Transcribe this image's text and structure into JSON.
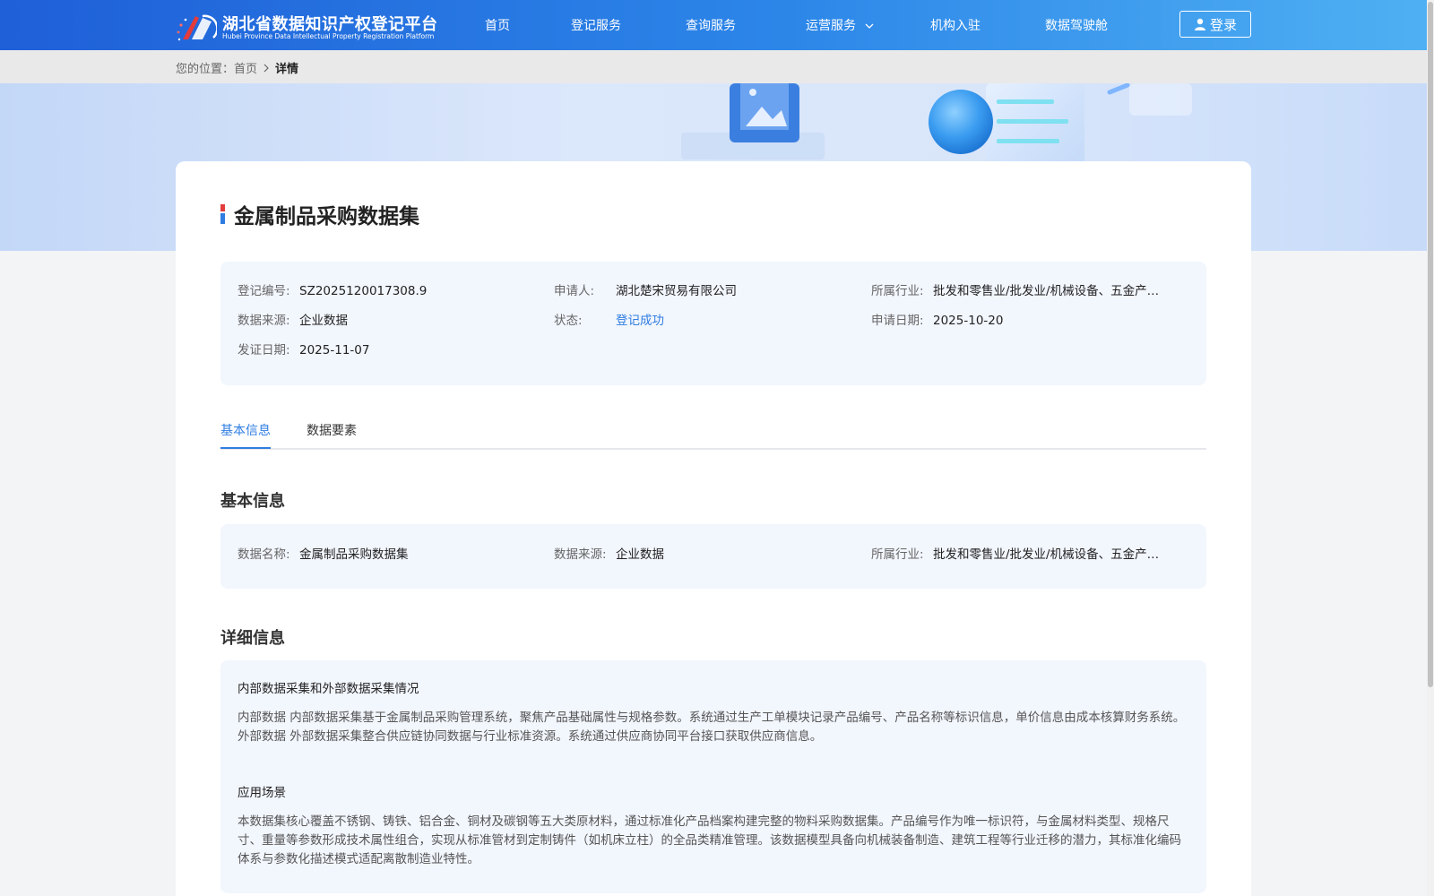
{
  "header": {
    "logo": {
      "title_cn": "湖北省数据知识产权登记平台",
      "title_en": "Hubei Province Data Intellectual Property Registration Platform"
    },
    "nav": [
      {
        "label": "首页"
      },
      {
        "label": "登记服务"
      },
      {
        "label": "查询服务"
      },
      {
        "label": "运营服务",
        "has_dropdown": true
      },
      {
        "label": "机构入驻"
      },
      {
        "label": "数据驾驶舱"
      }
    ],
    "login_label": "登录",
    "colors": {
      "gradient_start": "#1f5fd8",
      "gradient_end": "#4fb0f3"
    }
  },
  "breadcrumb": {
    "prefix": "您的位置：",
    "home": "首页",
    "current": "详情"
  },
  "detail": {
    "title": "金属制品采购数据集",
    "summary": {
      "reg_no_label": "登记编号:",
      "reg_no": "SZ2025120017308.9",
      "applicant_label": "申请人:",
      "applicant": "湖北楚宋贸易有限公司",
      "industry_label": "所属行业:",
      "industry": "批发和零售业/批发业/机械设备、五金产…",
      "source_label": "数据来源:",
      "source": "企业数据",
      "status_label": "状态:",
      "status": "登记成功",
      "apply_date_label": "申请日期:",
      "apply_date": "2025-10-20",
      "cert_date_label": "发证日期:",
      "cert_date": "2025-11-07"
    },
    "tabs": [
      {
        "label": "基本信息",
        "active": true
      },
      {
        "label": "数据要素",
        "active": false
      }
    ],
    "basic": {
      "heading": "基本信息",
      "name_label": "数据名称:",
      "name": "金属制品采购数据集",
      "source_label": "数据来源:",
      "source": "企业数据",
      "industry_label": "所属行业:",
      "industry": "批发和零售业/批发业/机械设备、五金产…"
    },
    "detailed": {
      "heading": "详细信息",
      "collection_heading": "内部数据采集和外部数据采集情况",
      "collection_text": "内部数据 内部数据采集基于金属制品采购管理系统，聚焦产品基础属性与规格参数。系统通过生产工单模块记录产品编号、产品名称等标识信息，单价信息由成本核算财务系统。 外部数据 外部数据采集整合供应链协同数据与行业标准资源。系统通过供应商协同平台接口获取供应商信息。",
      "scenario_heading": "应用场景",
      "scenario_text": "本数据集核心覆盖不锈钢、铸铁、铝合金、铜材及碳钢等五大类原材料，通过标准化产品档案构建完整的物料采购数据集。产品编号作为唯一标识符，与金属材料类型、规格尺寸、重量等参数形成技术属性组合，实现从标准管材到定制铸件（如机床立柱）的全品类精准管理。该数据模型具备向机械装备制造、建筑工程等行业迁移的潜力，其标准化编码体系与参数化描述模式适配离散制造业特性。"
    },
    "colors": {
      "accent": "#2f7de1",
      "panel_bg": "#f2f6fd"
    }
  }
}
